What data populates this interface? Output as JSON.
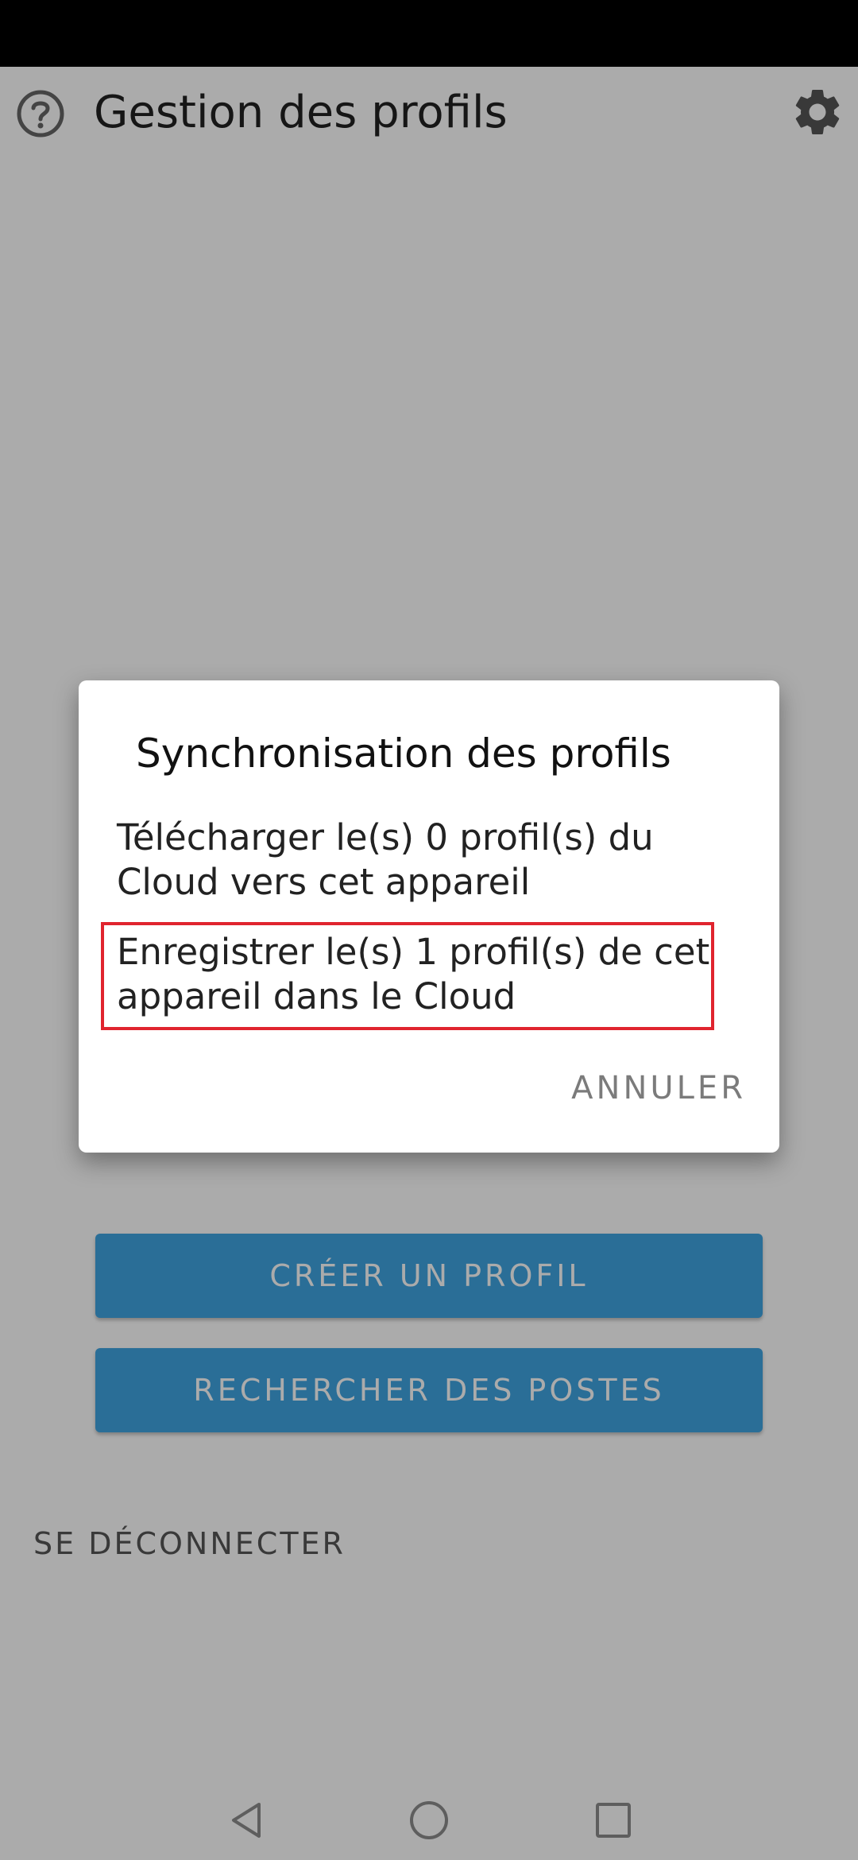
{
  "app_bar": {
    "title": "Gestion des profils",
    "help_icon": "help-circle-icon",
    "settings_icon": "gear-icon"
  },
  "buttons": {
    "create_profile": "CRÉER UN PROFIL",
    "search_stations": "RECHERCHER DES POSTES",
    "logout": "SE DÉCONNECTER"
  },
  "dialog": {
    "title": "Synchronisation des profils",
    "items": [
      {
        "label": "Télécharger le(s) 0 profil(s) du Cloud vers cet appareil"
      },
      {
        "label": "Enregistrer le(s) 1 profil(s) de cet appareil dans le Cloud",
        "highlighted": true
      }
    ],
    "cancel_label": "ANNULER"
  },
  "nav": {
    "back_icon": "back-triangle-icon",
    "home_icon": "home-circle-icon",
    "recent_icon": "recent-apps-square-icon"
  },
  "colors": {
    "primary_button": "#3fa4e2",
    "highlight_border": "#e0242e",
    "scrim": "rgba(0,0,0,0.33)"
  }
}
